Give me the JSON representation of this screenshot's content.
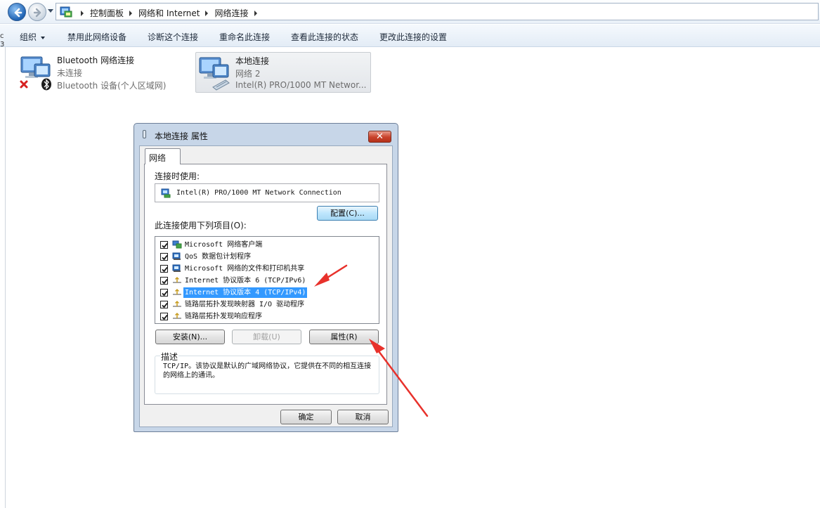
{
  "address_bar": {
    "breadcrumbs": [
      "控制面板",
      "网络和 Internet",
      "网络连接"
    ]
  },
  "command_bar": {
    "items": [
      "组织",
      "禁用此网络设备",
      "诊断这个连接",
      "重命名此连接",
      "查看此连接的状态",
      "更改此连接的设置"
    ]
  },
  "left_edge_fragment": {
    "line1": "c",
    "line2": "3"
  },
  "connections": [
    {
      "name": "Bluetooth 网络连接",
      "status": "未连接",
      "device": "Bluetooth 设备(个人区域网)",
      "selected": false
    },
    {
      "name": "本地连接",
      "status": "网络  2",
      "device": "Intel(R) PRO/1000 MT Networ...",
      "selected": true
    }
  ],
  "dialog": {
    "title": "本地连接 属性",
    "close_label": "✕",
    "tab_label": "网络",
    "connect_using_label": "连接时使用:",
    "adapter_name": "Intel(R) PRO/1000 MT Network Connection",
    "configure_button": "配置(C)...",
    "items_label": "此连接使用下列项目(O):",
    "items": [
      {
        "label": "Microsoft 网络客户端",
        "checked": true,
        "icon": "network-client-icon",
        "highlighted": false
      },
      {
        "label": "QoS 数据包计划程序",
        "checked": true,
        "icon": "qos-icon",
        "highlighted": false
      },
      {
        "label": "Microsoft 网络的文件和打印机共享",
        "checked": true,
        "icon": "file-share-icon",
        "highlighted": false
      },
      {
        "label": "Internet 协议版本 6 (TCP/IPv6)",
        "checked": true,
        "icon": "protocol-icon",
        "highlighted": false
      },
      {
        "label": "Internet 协议版本 4 (TCP/IPv4)",
        "checked": true,
        "icon": "protocol-icon",
        "highlighted": true
      },
      {
        "label": "链路层拓扑发现映射器 I/O 驱动程序",
        "checked": true,
        "icon": "protocol-icon",
        "highlighted": false
      },
      {
        "label": "链路层拓扑发现响应程序",
        "checked": true,
        "icon": "protocol-icon",
        "highlighted": false
      }
    ],
    "install_button": "安装(N)...",
    "uninstall_button": "卸载(U)",
    "properties_button": "属性(R)",
    "description_legend": "描述",
    "description_text": "TCP/IP。该协议是默认的广域网络协议，它提供在不同的相互连接的网络上的通讯。",
    "ok_button": "确定",
    "cancel_button": "取消"
  },
  "colors": {
    "highlight": "#3399ff",
    "annotation_arrow": "#e8312b",
    "dialog_frame": "#c7d6e8"
  }
}
